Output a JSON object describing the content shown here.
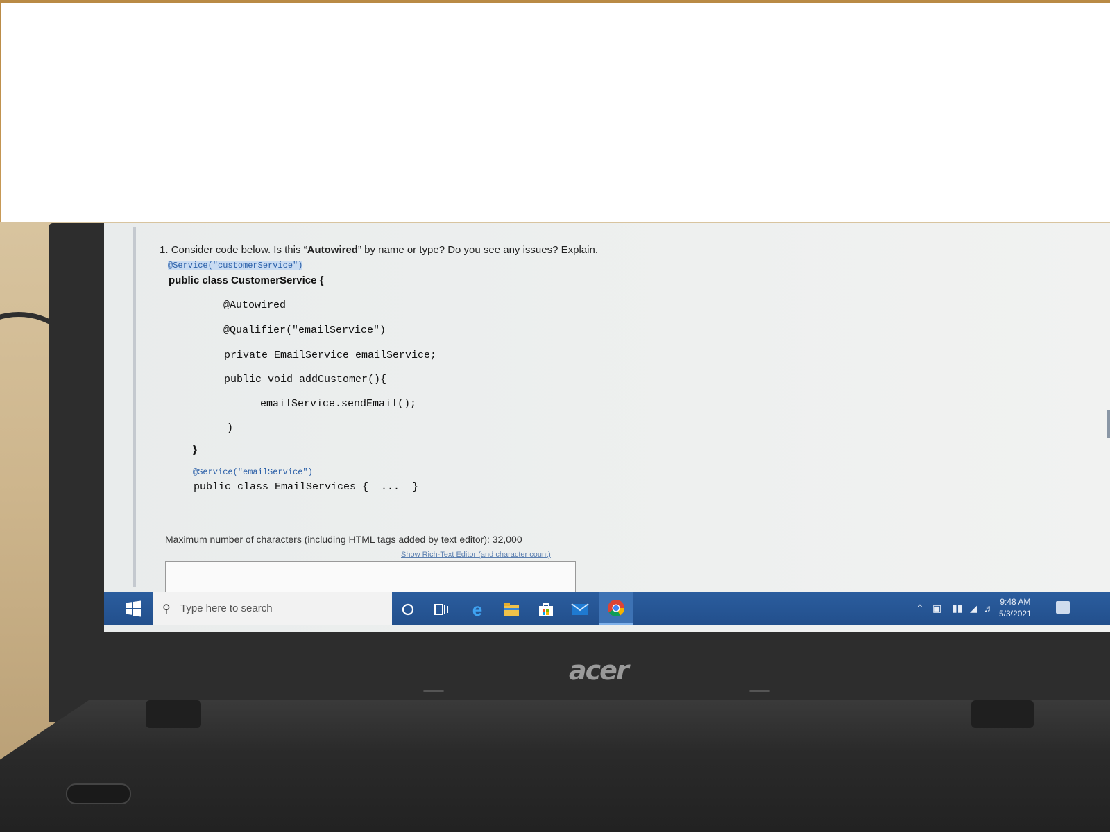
{
  "question": {
    "number": "1.",
    "prefix": "Consider code below. Is this “",
    "emphasis": "Autowired",
    "suffix": "” by name or type? Do you see any issues? Explain."
  },
  "code": {
    "annotation_customer": "@Service(\"customerService\")",
    "class_customer": "public class CustomerService {",
    "autowired": "@Autowired",
    "qualifier": "@Qualifier(\"emailService\")",
    "field": "private EmailService emailService;",
    "method": "public void addCustomer(){",
    "call": "emailService.sendEmail();",
    "close_method": ")",
    "close_class": "}",
    "annotation_email": "@Service(\"emailService\")",
    "class_email": "public class EmailServices {  ...  }"
  },
  "editor": {
    "max_chars": "Maximum number of characters (including HTML tags added by text editor): 32,000",
    "rich_text_link": "Show Rich-Text Editor (and character count)"
  },
  "taskbar": {
    "search_placeholder": "Type here to search",
    "time": "9:48 AM",
    "date": "5/3/2021",
    "icons": [
      "windows-icon",
      "cortana-icon",
      "task-view-icon",
      "edge-icon",
      "file-explorer-icon",
      "store-icon",
      "mail-icon",
      "chrome-icon"
    ]
  },
  "device": {
    "brand": "acer"
  }
}
